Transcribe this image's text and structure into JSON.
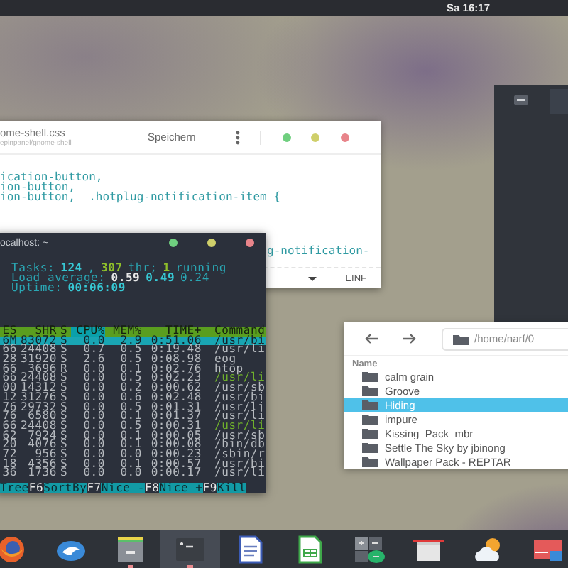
{
  "top_bar": {
    "clock": "Sa 16:17"
  },
  "editor": {
    "title": "ome-shell.css",
    "path": "epinpanel/gnome-shell",
    "save": "Speichern",
    "code_top": [
      "ication-button,",
      "ion-button,",
      "ion-button,  .hotplug-notification-item {"
    ],
    "code_bottom": [
      "g-notification-"
    ],
    "mode": "EINF"
  },
  "terminal": {
    "title": "ocalhost: ~",
    "summary": [
      [
        {
          "kind": "label",
          "text": "Tasks:"
        },
        {
          "kind": "num",
          "text": "124"
        },
        {
          "kind": "label",
          "text": ","
        },
        {
          "kind": "green",
          "text": "307"
        },
        {
          "kind": "label",
          "text": "thr;"
        },
        {
          "kind": "green",
          "text": "1"
        },
        {
          "kind": "label",
          "text": "running"
        }
      ],
      [
        {
          "kind": "label",
          "text": "Load average:"
        },
        {
          "kind": "white",
          "text": "0.59"
        },
        {
          "kind": "num",
          "text": "0.49"
        },
        {
          "kind": "label",
          "text": "0.24"
        }
      ],
      [
        {
          "kind": "label",
          "text": "Uptime:"
        },
        {
          "kind": "num",
          "text": "00:06:09"
        }
      ]
    ],
    "columns": [
      {
        "label": "ES",
        "selected": false
      },
      {
        "label": "SHR",
        "selected": false
      },
      {
        "label": "S",
        "selected": false
      },
      {
        "label": "CPU%",
        "selected": true
      },
      {
        "label": "MEM%",
        "selected": false
      },
      {
        "label": "TIME+",
        "selected": false
      },
      {
        "label": "Command",
        "selected": false
      }
    ],
    "rows": [
      {
        "cells": [
          "6M",
          "83072",
          "S",
          "0.0",
          "2.9",
          "0:51.06",
          "/usr/bi"
        ],
        "selected": true,
        "kind": "process"
      },
      {
        "cells": [
          "66",
          "24408",
          "S",
          "0.7",
          "0.5",
          "0:19.48",
          "/usr/li"
        ],
        "selected": false,
        "kind": "process"
      },
      {
        "cells": [
          "28",
          "31920",
          "S",
          "2.6",
          "0.5",
          "0:08.98",
          "eog"
        ],
        "selected": false,
        "kind": "process"
      },
      {
        "cells": [
          "66",
          "3696",
          "R",
          "0.0",
          "0.1",
          "0:02.76",
          "htop"
        ],
        "selected": false,
        "kind": "process"
      },
      {
        "cells": [
          "66",
          "24408",
          "S",
          "0.0",
          "0.5",
          "0:02.23",
          "/usr/li"
        ],
        "selected": false,
        "kind": "thread"
      },
      {
        "cells": [
          "00",
          "14312",
          "S",
          "0.0",
          "0.2",
          "0:00.62",
          "/usr/sb"
        ],
        "selected": false,
        "kind": "process"
      },
      {
        "cells": [
          "12",
          "31276",
          "S",
          "0.0",
          "0.6",
          "0:02.48",
          "/usr/bi"
        ],
        "selected": false,
        "kind": "process"
      },
      {
        "cells": [
          "76",
          "29732",
          "S",
          "0.0",
          "0.5",
          "0:01.31",
          "/usr/li"
        ],
        "selected": false,
        "kind": "process"
      },
      {
        "cells": [
          "76",
          "6580",
          "S",
          "0.0",
          "0.1",
          "0:01.37",
          "/usr/li"
        ],
        "selected": false,
        "kind": "process"
      },
      {
        "cells": [
          "66",
          "24408",
          "S",
          "0.0",
          "0.5",
          "0:00.31",
          "/usr/li"
        ],
        "selected": false,
        "kind": "thread"
      },
      {
        "cells": [
          "62",
          "7924",
          "S",
          "0.0",
          "0.1",
          "0:00.05",
          "/usr/sb"
        ],
        "selected": false,
        "kind": "process"
      },
      {
        "cells": [
          "20",
          "4076",
          "S",
          "0.0",
          "0.1",
          "0:00.08",
          "/bin/db"
        ],
        "selected": false,
        "kind": "process"
      },
      {
        "cells": [
          "72",
          "956",
          "S",
          "0.0",
          "0.0",
          "0:00.23",
          "/sbin/r"
        ],
        "selected": false,
        "kind": "process"
      },
      {
        "cells": [
          "18",
          "4356",
          "S",
          "0.0",
          "0.1",
          "0:00.57",
          "/usr/bi"
        ],
        "selected": false,
        "kind": "process"
      },
      {
        "cells": [
          "36",
          "1736",
          "S",
          "0.0",
          "0.0",
          "0:00.17",
          "/usr/li"
        ],
        "selected": false,
        "kind": "process"
      }
    ],
    "function_keys": [
      {
        "label": "Tree"
      },
      {
        "key": "F6",
        "label": "SortBy"
      },
      {
        "key": "F7",
        "label": "Nice -"
      },
      {
        "key": "F8",
        "label": "Nice +"
      },
      {
        "key": "F9",
        "label": "Kill"
      }
    ]
  },
  "file_manager": {
    "path": "/home/narf/0",
    "column": "Name",
    "items": [
      {
        "name": "calm grain",
        "selected": false
      },
      {
        "name": "Groove",
        "selected": false
      },
      {
        "name": "Hiding",
        "selected": true
      },
      {
        "name": "impure",
        "selected": false
      },
      {
        "name": "Kissing_Pack_mbr",
        "selected": false
      },
      {
        "name": "Settle The Sky by jbinong",
        "selected": false
      },
      {
        "name": "Wallpaper Pack - REPTAR",
        "selected": false
      }
    ]
  },
  "dock": {
    "items": [
      {
        "kind": "browser",
        "running": false,
        "selected": false
      },
      {
        "kind": "mail",
        "running": false,
        "selected": false
      },
      {
        "kind": "files",
        "running": true,
        "selected": false
      },
      {
        "kind": "terminal",
        "running": true,
        "selected": true
      },
      {
        "kind": "document",
        "running": false,
        "selected": false
      },
      {
        "kind": "spreadsheet",
        "running": false,
        "selected": false
      },
      {
        "kind": "calculator",
        "running": false,
        "selected": false
      },
      {
        "kind": "screenshot",
        "running": false,
        "selected": false
      },
      {
        "kind": "weather",
        "running": false,
        "selected": false
      },
      {
        "kind": "card",
        "running": false,
        "selected": false
      }
    ]
  }
}
